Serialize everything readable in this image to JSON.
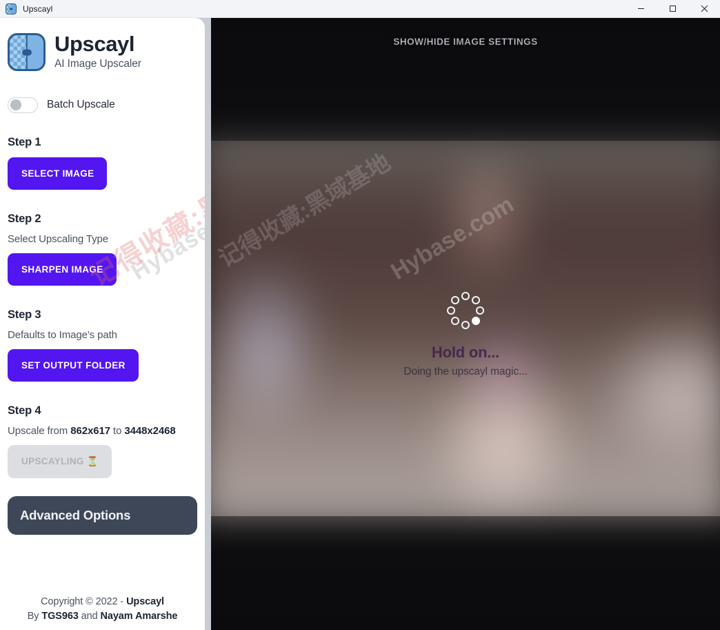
{
  "window": {
    "title": "Upscayl",
    "icon": "app-checker-icon",
    "controls": {
      "minimize": "minimize-icon",
      "maximize": "maximize-icon",
      "close": "close-icon"
    }
  },
  "colors": {
    "accent_purple": "#5316f0",
    "panel_dark": "#3d4757",
    "sidebar_bg": "#ffffff",
    "viewer_bg": "#0d0d0f",
    "disabled_bg": "#dcdee1",
    "disabled_text": "#aeb2b8",
    "logo_blue": "#2a5d8f"
  },
  "sidebar": {
    "brand": {
      "title": "Upscayl",
      "subtitle": "AI Image Upscaler",
      "logo_icon": "upscayl-logo-icon"
    },
    "batch": {
      "label": "Batch Upscale",
      "enabled": false
    },
    "steps": [
      {
        "heading": "Step 1",
        "note": "",
        "button": "SELECT IMAGE"
      },
      {
        "heading": "Step 2",
        "note": "Select Upscaling Type",
        "button": "SHARPEN IMAGE"
      },
      {
        "heading": "Step 3",
        "note": "Defaults to Image's path",
        "button": "SET OUTPUT FOLDER"
      },
      {
        "heading": "Step 4",
        "note_prefix": "Upscale from ",
        "note_from": "862x617",
        "note_middle": " to ",
        "note_to": "3448x2468",
        "button": "UPSCAYLING",
        "button_icon": "hourglass-icon",
        "button_disabled": true
      }
    ],
    "advanced_options": "Advanced Options",
    "footer": {
      "line1_prefix": "Copyright © 2022 - ",
      "line1_bold": "Upscayl",
      "line2_prefix": "By ",
      "line2_bold1": "TGS963",
      "line2_middle": " and ",
      "line2_bold2": "Nayam Amarshe"
    },
    "watermark_cn": "记得收藏:黑域基地",
    "watermark_en": "Hybase.com"
  },
  "viewer": {
    "settings_toggle": "SHOW/HIDE IMAGE SETTINGS",
    "loading": {
      "spinner_icon": "loading-spinner-icon",
      "heading": "Hold on...",
      "message": "Doing the upscayl magic..."
    },
    "watermark_cn": "记得收藏:黑域基地",
    "watermark_en": "Hybase.com"
  }
}
